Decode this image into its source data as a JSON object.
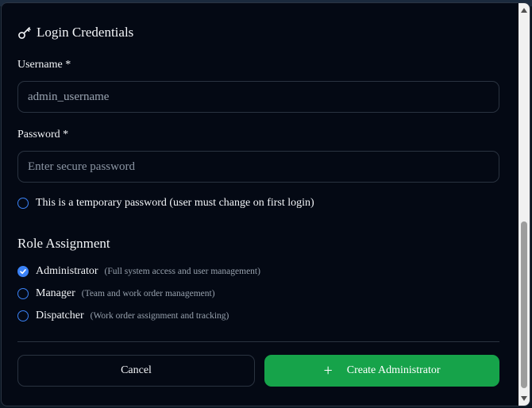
{
  "section": {
    "title": "Login Credentials",
    "icon": "key-icon"
  },
  "username": {
    "label": "Username *",
    "value": "admin_username",
    "placeholder": ""
  },
  "password": {
    "label": "Password *",
    "value": "",
    "placeholder": "Enter secure password"
  },
  "temporary_password": {
    "label": "This is a temporary password (user must change on first login)",
    "checked": false
  },
  "roles": {
    "heading": "Role Assignment",
    "options": [
      {
        "label": "Administrator",
        "description": "(Full system access and user management)",
        "checked": true
      },
      {
        "label": "Manager",
        "description": "(Team and work order management)",
        "checked": false
      },
      {
        "label": "Dispatcher",
        "description": "(Work order assignment and tracking)",
        "checked": false
      }
    ]
  },
  "actions": {
    "cancel": "Cancel",
    "create": "Create Administrator"
  },
  "colors": {
    "accent": "#3b82f6",
    "primary_button": "#16a34a",
    "background": "#040914"
  }
}
